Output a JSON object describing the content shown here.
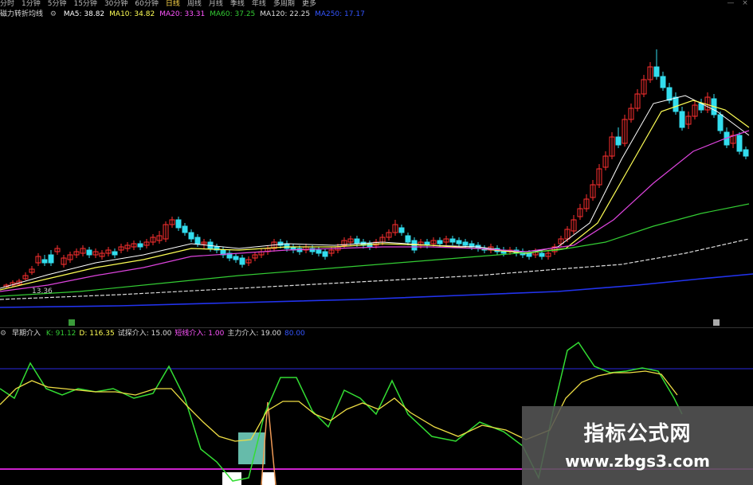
{
  "toolbar": {
    "tabs": [
      "分时",
      "1分钟",
      "5分钟",
      "15分钟",
      "30分钟",
      "60分钟",
      "日线",
      "周线",
      "月线",
      "季线",
      "年线",
      "多周期",
      "更多"
    ],
    "active_tab": "日线"
  },
  "window_buttons": [
    "—",
    "×"
  ],
  "ma_legend": {
    "title": "磁力转折均线",
    "items": [
      {
        "label": "MA5: 38.82",
        "color": "#ffffff"
      },
      {
        "label": "MA10: 34.82",
        "color": "#ffff55"
      },
      {
        "label": "MA20: 33.31",
        "color": "#ff55ff"
      },
      {
        "label": "MA60: 37.25",
        "color": "#33cc33"
      },
      {
        "label": "MA120: 22.25",
        "color": "#dddddd"
      },
      {
        "label": "MA250: 17.17",
        "color": "#3355ff"
      }
    ]
  },
  "price_annotation": "13.36",
  "indicator_legend": {
    "title": "早期介入",
    "items": [
      {
        "label": "K: 91.12",
        "color": "#33cc33"
      },
      {
        "label": "D: 116.35",
        "color": "#ffff55"
      },
      {
        "label": "试探介入: 15.00",
        "color": "#dddddd"
      },
      {
        "label": "短线介入: 1.00",
        "color": "#ff55ff"
      },
      {
        "label": "主力介入: 19.00",
        "color": "#dddddd"
      },
      {
        "label": "80.00",
        "color": "#3355ff"
      }
    ]
  },
  "watermark": {
    "title": "指标公式网",
    "url": "www.zbgs3.com"
  },
  "colors": {
    "up": "#ff3030",
    "down": "#33ddee",
    "ma5": "#ffffff",
    "ma10": "#ffff55",
    "ma20": "#dd44dd",
    "ma60": "#33cc33",
    "ma120": "#dddddd",
    "ma250": "#2233ee",
    "k_line": "#33dd33",
    "d_line": "#eedd44",
    "level_80": "#2a2ae0",
    "level_0": "#cc22cc",
    "signal_box": "#66bbaa"
  }
}
